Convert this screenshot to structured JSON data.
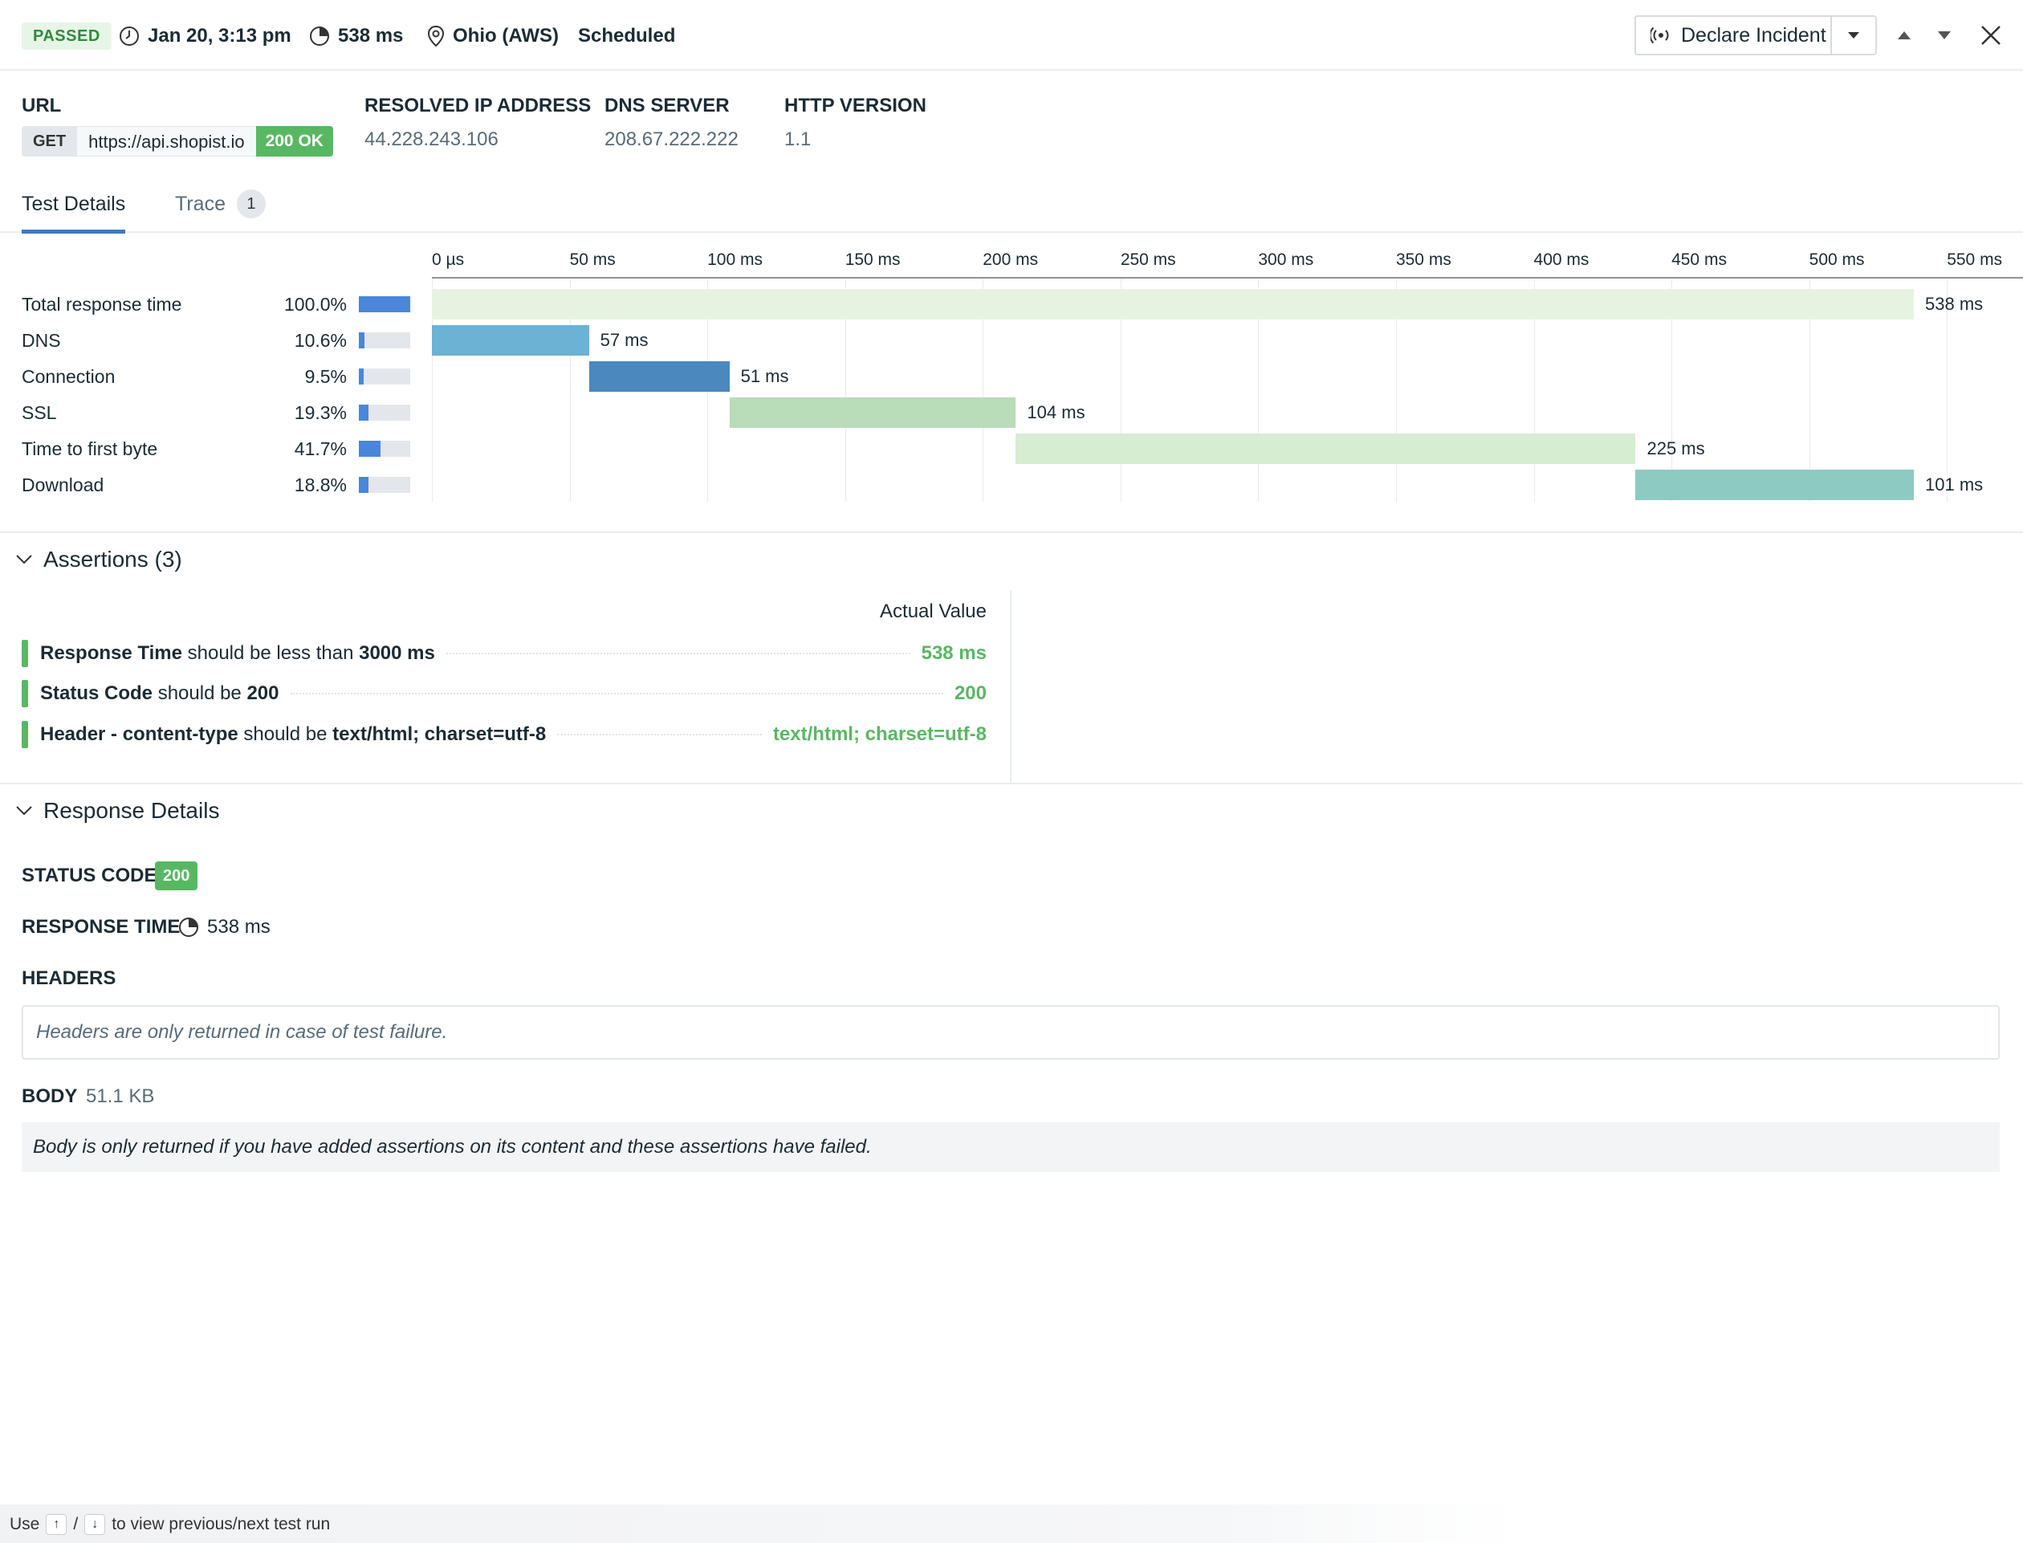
{
  "header": {
    "status": "PASSED",
    "datetime": "Jan 20, 3:13 pm",
    "duration": "538 ms",
    "location": "Ohio (AWS)",
    "trigger": "Scheduled",
    "declare_label": "Declare Incident"
  },
  "request": {
    "url_label": "URL",
    "method": "GET",
    "url": "https://api.shopist.io",
    "status": "200 OK",
    "ip_label": "RESOLVED IP ADDRESS",
    "ip": "44.228.243.106",
    "dns_label": "DNS SERVER",
    "dns": "208.67.222.222",
    "http_label": "HTTP VERSION",
    "http": "1.1"
  },
  "tabs": [
    {
      "label": "Test Details"
    },
    {
      "label": "Trace",
      "count": "1"
    }
  ],
  "chart_data": {
    "type": "bar",
    "subtype": "waterfall",
    "x_unit": "ms",
    "xlim": [
      0,
      576
    ],
    "ticks": [
      "0 µs",
      "50 ms",
      "100 ms",
      "150 ms",
      "200 ms",
      "250 ms",
      "300 ms",
      "350 ms",
      "400 ms",
      "450 ms",
      "500 ms",
      "550 ms"
    ],
    "tick_values": [
      0,
      50,
      100,
      150,
      200,
      250,
      300,
      350,
      400,
      450,
      500,
      550
    ],
    "rows": [
      {
        "label": "Total response time",
        "pct": "100.0%",
        "fraction": 1.0,
        "start": 0,
        "value": 538,
        "text": "538 ms",
        "color": "#e6f3e1"
      },
      {
        "label": "DNS",
        "pct": "10.6%",
        "fraction": 0.106,
        "start": 0,
        "value": 57,
        "text": "57 ms",
        "color": "#6bb2d4"
      },
      {
        "label": "Connection",
        "pct": "9.5%",
        "fraction": 0.095,
        "start": 57,
        "value": 51,
        "text": "51 ms",
        "color": "#4a88bd"
      },
      {
        "label": "SSL",
        "pct": "19.3%",
        "fraction": 0.193,
        "start": 108,
        "value": 104,
        "text": "104 ms",
        "color": "#b8ddb8"
      },
      {
        "label": "Time to first byte",
        "pct": "41.7%",
        "fraction": 0.417,
        "start": 212,
        "value": 225,
        "text": "225 ms",
        "color": "#d6edd1"
      },
      {
        "label": "Download",
        "pct": "18.8%",
        "fraction": 0.188,
        "start": 437,
        "value": 101,
        "text": "101 ms",
        "color": "#8dcbc2"
      }
    ]
  },
  "assertions": {
    "title": "Assertions (3)",
    "actual_header": "Actual Value",
    "items": [
      {
        "subject": "Response Time",
        "op": "should be less than",
        "target": "3000 ms",
        "actual": "538 ms"
      },
      {
        "subject": "Status Code",
        "op": "should be",
        "target": "200",
        "actual": "200"
      },
      {
        "subject": "Header - content-type",
        "op": "should be",
        "target": "text/html; charset=utf-8",
        "actual": "text/html; charset=utf-8"
      }
    ]
  },
  "response": {
    "title": "Response Details",
    "status_label": "STATUS CODE",
    "status_code": "200",
    "time_label": "RESPONSE TIME",
    "time": "538 ms",
    "headers_label": "HEADERS",
    "headers_msg": "Headers are only returned in case of test failure.",
    "body_label": "BODY",
    "body_size": "51.1 KB",
    "body_msg": "Body is only returned if you have added assertions on its content and these assertions have failed."
  },
  "footer": {
    "use": "Use",
    "up_key": "↑",
    "slash": "/",
    "down_key": "↓",
    "rest": "to view previous/next test run"
  }
}
